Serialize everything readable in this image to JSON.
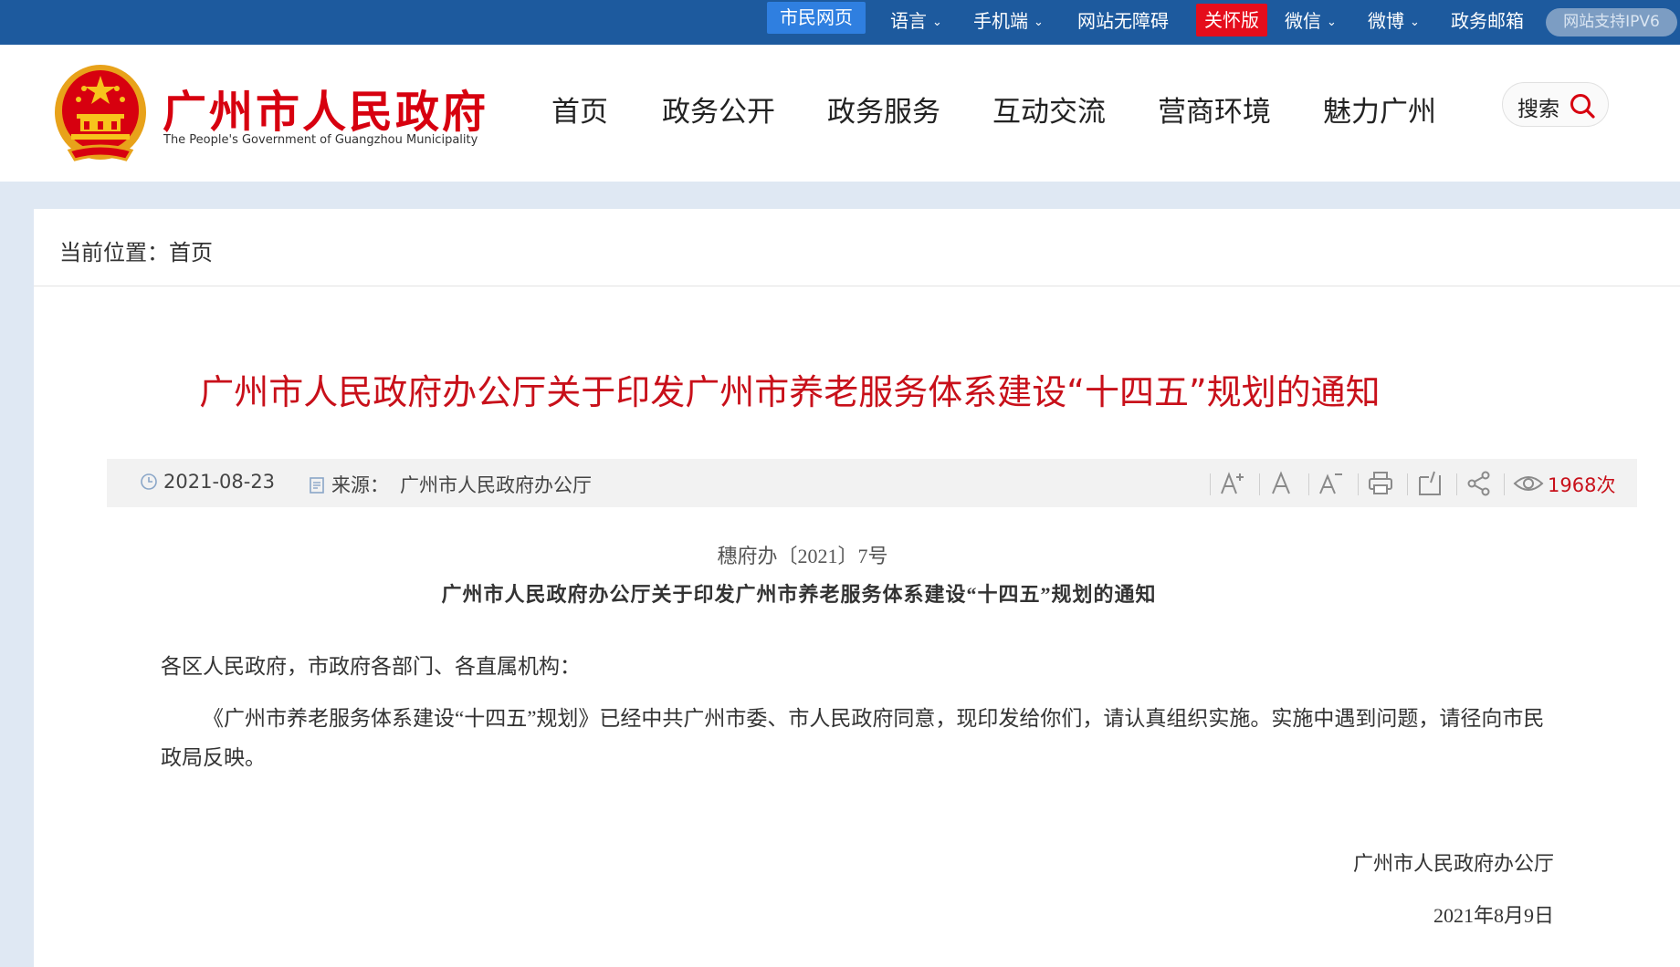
{
  "topbar": {
    "citizen_page": "市民网页",
    "language": "语言",
    "mobile": "手机端",
    "accessibility": "网站无障碍",
    "care_version": "关怀版",
    "wechat": "微信",
    "weibo": "微博",
    "mail": "政务邮箱",
    "ipv6": "网站支持IPV6"
  },
  "header": {
    "title": "广州市人民政府",
    "subtitle": "The People's Government of Guangzhou Municipality",
    "nav": [
      "首页",
      "政务公开",
      "政务服务",
      "互动交流",
      "营商环境",
      "魅力广州"
    ],
    "search_label": "搜索"
  },
  "breadcrumb": "当前位置：首页",
  "article": {
    "title": "广州市人民政府办公厅关于印发广州市养老服务体系建设“十四五”规划的通知",
    "date": "2021-08-23",
    "source_label": "来源：",
    "source": "广州市人民政府办公厅",
    "views": "1968次",
    "doc_number": "穗府办〔2021〕7号",
    "doc_title": "广州市人民政府办公厅关于印发广州市养老服务体系建设“十四五”规划的通知",
    "greeting": "各区人民政府，市政府各部门、各直属机构：",
    "body": "《广州市养老服务体系建设“十四五”规划》已经中共广州市委、市人民政府同意，现印发给你们，请认真组织实施。实施中遇到问题，请径向市民政局反映。",
    "signature": "广州市人民政府办公厅",
    "sign_date": "2021年8月9日"
  },
  "colors": {
    "topbar": "#1d5a9e",
    "brand_red": "#d7000f",
    "title_red": "#c8101a",
    "page_bg": "#dfe8f3"
  },
  "icons": [
    "chevron-down-icon",
    "national-emblem-icon",
    "search-icon",
    "clock-icon",
    "document-icon",
    "font-increase-icon",
    "font-default-icon",
    "font-decrease-icon",
    "print-icon",
    "close-page-icon",
    "share-icon",
    "eye-icon"
  ]
}
